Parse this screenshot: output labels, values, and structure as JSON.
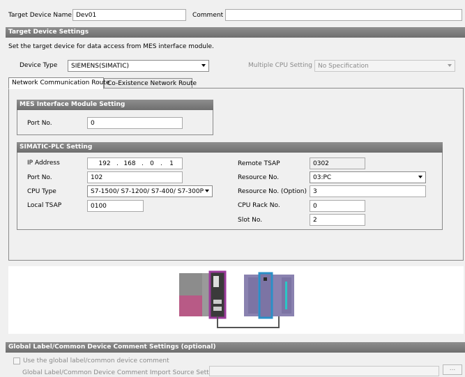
{
  "header": {
    "target_device_name_label": "Target Device Name",
    "target_device_name_value": "Dev01",
    "comment_label": "Comment",
    "comment_value": ""
  },
  "target_device_settings": {
    "title": "Target Device Settings",
    "description": "Set the target device for data access from MES interface module.",
    "device_type_label": "Device Type",
    "device_type_value": "SIEMENS(SIMATIC)",
    "multiple_cpu_label": "Multiple CPU Setting",
    "multiple_cpu_value": "No Specification"
  },
  "tabs": [
    {
      "label": "Network Communication Route",
      "active": true
    },
    {
      "label": "Co-Existence Network Route",
      "active": false
    }
  ],
  "mes_setting": {
    "title": "MES Interface Module Setting",
    "port_label": "Port No.",
    "port_value": "0"
  },
  "simatic": {
    "title": "SIMATIC-PLC Setting",
    "ip_label": "IP Address",
    "ip": [
      "192",
      "168",
      "0",
      "1"
    ],
    "ip_sep": ".",
    "port_label": "Port No.",
    "port_value": "102",
    "cpu_type_label": "CPU Type",
    "cpu_type_value": "S7-1500/ S7-1200/ S7-400/ S7-300P",
    "local_tsap_label": "Local TSAP",
    "local_tsap_value": "0100",
    "remote_tsap_label": "Remote TSAP",
    "remote_tsap_value": "0302",
    "resource_label": "Resource No.",
    "resource_value": "03:PC",
    "resource_opt_label": "Resource No. (Option)",
    "resource_opt_value": "3",
    "rack_label": "CPU Rack No.",
    "rack_value": "0",
    "slot_label": "Slot No.",
    "slot_value": "2"
  },
  "global_label": {
    "title": "Global Label/Common Device Comment Settings (optional)",
    "checkbox_label": "Use the global label/common device comment",
    "checked": false,
    "import_label": "Global Label/Common Device Comment Import Source Setting",
    "import_value": "",
    "browse_label": "..."
  },
  "colors": {
    "section_bar": "#7e7e7e",
    "mes_highlight": "#9b3a9b",
    "plc_highlight": "#2a8fc7",
    "module_body": "#8a82b0"
  },
  "icons": [
    "checkbox-icon",
    "chevron-down-icon",
    "diagram-icon"
  ]
}
